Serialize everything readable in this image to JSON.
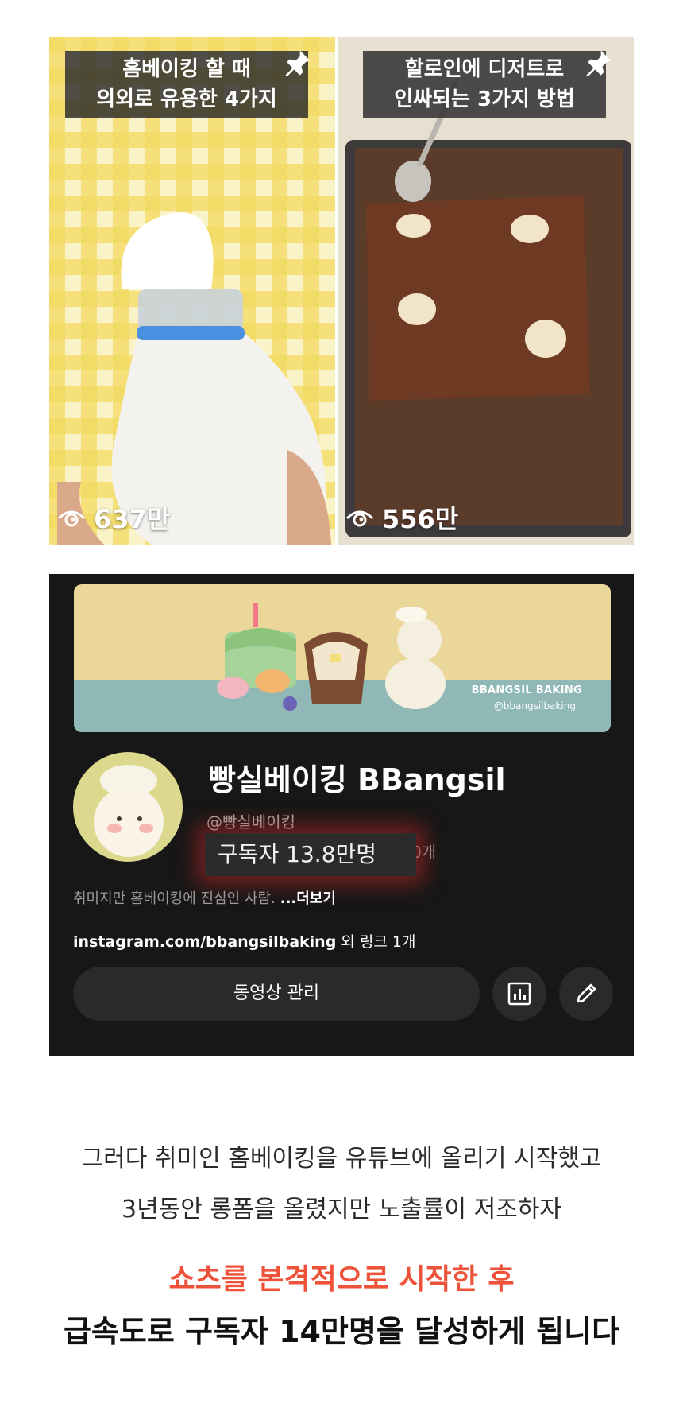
{
  "shorts": [
    {
      "caption_line1": "홈베이킹 할 때",
      "caption_line2": "의외로 유용한 4가지",
      "views": "637만",
      "pin_icon": "pin-icon",
      "views_icon": "eye-icon"
    },
    {
      "caption_line1": "할로인에 디저트로",
      "caption_line2": "인싸되는 3가지 방법",
      "views": "556만",
      "pin_icon": "pin-icon",
      "views_icon": "eye-icon"
    }
  ],
  "channel": {
    "banner_brand": "BBANGSIL BAKING",
    "banner_handle": "@bbangsilbaking",
    "name": "빵실베이킹 BBangsil",
    "handle": "@빵실베이킹",
    "subscribers": "구독자 13.8만명",
    "count_tail": "0개",
    "description": "취미지만 홈베이킹에 진심인 사람.",
    "more_label": "...더보기",
    "link_url": "instagram.com/bbangsilbaking",
    "link_tail": " 외 링크 1개",
    "manage_button": "동영상 관리",
    "stats_icon": "bar-chart-icon",
    "edit_icon": "pencil-icon",
    "background_color": "#171717",
    "highlight_glow_color": "#c82828"
  },
  "body": {
    "line1": "그러다 취미인 홈베이킹을 유튜브에 올리기 시작했고",
    "line2": "3년동안 롱폼을 올렸지만 노출률이 저조하자",
    "highlight": "쇼츠를 본격적으로 시작한 후",
    "highlight_color": "#ee5238",
    "strong": "급속도로 구독자 14만명을 달성하게 됩니다"
  }
}
